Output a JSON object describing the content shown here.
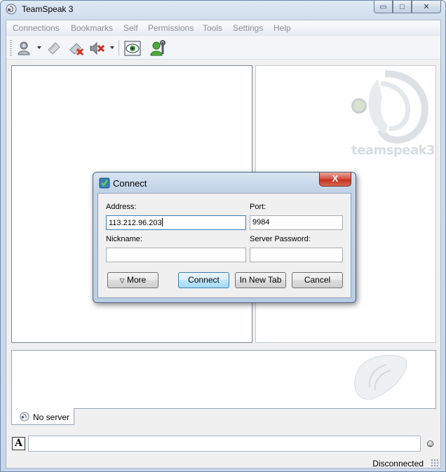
{
  "window": {
    "title": "TeamSpeak 3",
    "minimize_glyph": "▭",
    "maximize_glyph": "□",
    "close_glyph": "✕"
  },
  "menu": [
    {
      "label": "Connections"
    },
    {
      "label": "Bookmarks"
    },
    {
      "label": "Self"
    },
    {
      "label": "Permissions"
    },
    {
      "label": "Tools"
    },
    {
      "label": "Settings"
    },
    {
      "label": "Help"
    }
  ],
  "toolbar": {
    "icons": [
      "connect-icon",
      "bookmark-icon",
      "disconnect-icon",
      "mute-speakers-icon",
      "away-eye-icon",
      "identity-settings-icon"
    ]
  },
  "logo": {
    "text": "teamspeak3"
  },
  "tabs": [
    {
      "label": "No server"
    }
  ],
  "chat": {
    "format_glyph": "A",
    "smiley_glyph": "☺",
    "input_value": ""
  },
  "status": {
    "text": "Disconnected"
  },
  "dialog": {
    "title": "Connect",
    "close_glyph": "X",
    "address_label": "Address:",
    "address_value": "113.212.96.203",
    "port_label": "Port:",
    "port_value": "9984",
    "nickname_label": "Nickname:",
    "nickname_value": "",
    "password_label": "Server Password:",
    "password_value": "",
    "more_arrow": "▽",
    "more_label": "More",
    "connect_label": "Connect",
    "new_tab_label": "In New Tab",
    "cancel_label": "Cancel"
  },
  "colors": {
    "accent": "#3c7fb1",
    "close_red": "#c23222",
    "menu_disabled": "#8a8f96"
  }
}
